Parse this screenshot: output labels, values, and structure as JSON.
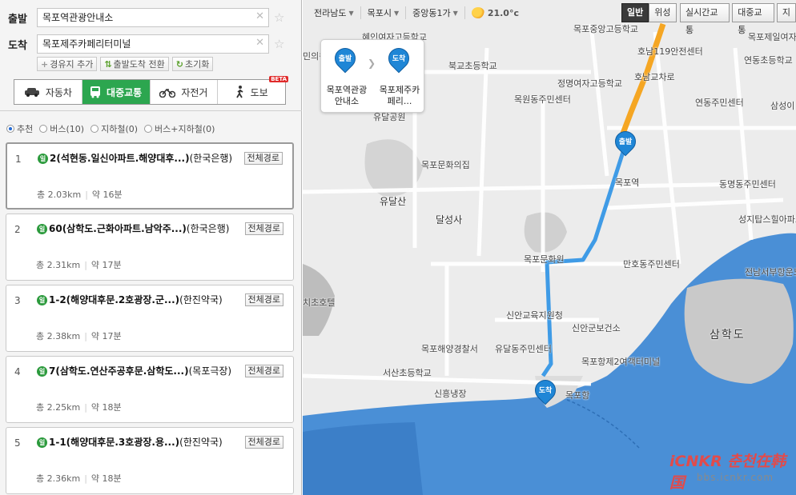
{
  "panel": {
    "from_label": "출발",
    "from_value": "목포역관광안내소",
    "to_label": "도착",
    "to_value": "목포제주카페리터미널",
    "sub_buttons": [
      "경유지 추가",
      "출발도착 전환",
      "초기화"
    ],
    "modes": [
      {
        "label": "자동차",
        "icon": "car-icon",
        "active": false
      },
      {
        "label": "대중교통",
        "icon": "bus-icon",
        "active": true
      },
      {
        "label": "자전거",
        "icon": "bicycle-icon",
        "active": false
      },
      {
        "label": "도보",
        "icon": "walk-icon",
        "active": false,
        "badge": "BETA"
      }
    ],
    "options": [
      {
        "label": "추천",
        "selected": true
      },
      {
        "label": "버스(10)",
        "selected": false
      },
      {
        "label": "지하철(0)",
        "selected": false
      },
      {
        "label": "버스+지하철(0)",
        "selected": false
      }
    ]
  },
  "routes": [
    {
      "num": "1",
      "badge": "일",
      "title": "2(석현동.일신아파트.해양대후...)",
      "suffix": "(한국은행)",
      "full_button": "전체경로",
      "total": "총 2.03km",
      "time": "약 16분"
    },
    {
      "num": "2",
      "badge": "일",
      "title": "60(삼학도.근화아파트.남악주...)",
      "suffix": "(한국은행)",
      "full_button": "전체경로",
      "total": "총 2.31km",
      "time": "약 17분"
    },
    {
      "num": "3",
      "badge": "일",
      "title": "1-2(해양대후문.2호광장.군...)",
      "suffix": "(한진약국)",
      "full_button": "전체경로",
      "total": "총 2.38km",
      "time": "약 17분"
    },
    {
      "num": "4",
      "badge": "일",
      "title": "7(삼학도.연산주공후문.삼학도...)",
      "suffix": "(목포극장)",
      "full_button": "전체경로",
      "total": "총 2.25km",
      "time": "약 18분"
    },
    {
      "num": "5",
      "badge": "일",
      "title": "1-1(해양대후문.3호광장.용...)",
      "suffix": "(한진약국)",
      "full_button": "전체경로",
      "total": "총 2.36km",
      "time": "약 18분"
    }
  ],
  "map": {
    "breadcrumbs": [
      "전라남도",
      "목포시",
      "중앙동1가"
    ],
    "weather_temp": "21.0°c",
    "view_buttons": [
      {
        "label": "일반",
        "active": true
      },
      {
        "label": "위성",
        "active": false
      }
    ],
    "layer_buttons": [
      "실시간교통",
      "대중교통",
      "지"
    ],
    "popup": {
      "start_pin": "출발",
      "start_text": "목포역관광안내소",
      "end_pin": "도착",
      "end_text": "목포제주카페리..."
    },
    "pins": {
      "start": "출발",
      "end": "도착"
    },
    "labels": [
      "혜인여자고등학교",
      "목포중앙고등학교",
      "호남119안전센터",
      "호남교차로",
      "목포제일여자고등학교",
      "연동초등학교",
      "북교초등학교",
      "정명여자고등학교",
      "목원동주민센터",
      "연동주민센터",
      "삼성이",
      "목포문화의집",
      "유달산",
      "달성사",
      "목포역",
      "동명동주민센터",
      "성지탑스힐아파트",
      "목포문화원",
      "만호동주민센터",
      "전남서부항운노동조합",
      "신안교육지원청",
      "신안군보건소",
      "목포해양경찰서",
      "유달동주민센터",
      "서산초등학교",
      "목포항제2여객터미널",
      "목포항",
      "신흥냉장",
      "삼학도",
      "치초호텔",
      "민의원",
      "유달공원"
    ],
    "watermark": "iCNKR 춘천在韩国",
    "watermark_url": "bbs.icnkr.com",
    "colors": {
      "route": "#3f9be6",
      "road": "#f5a623",
      "water": "#4a8fd6",
      "park": "#c9c9c9"
    }
  }
}
